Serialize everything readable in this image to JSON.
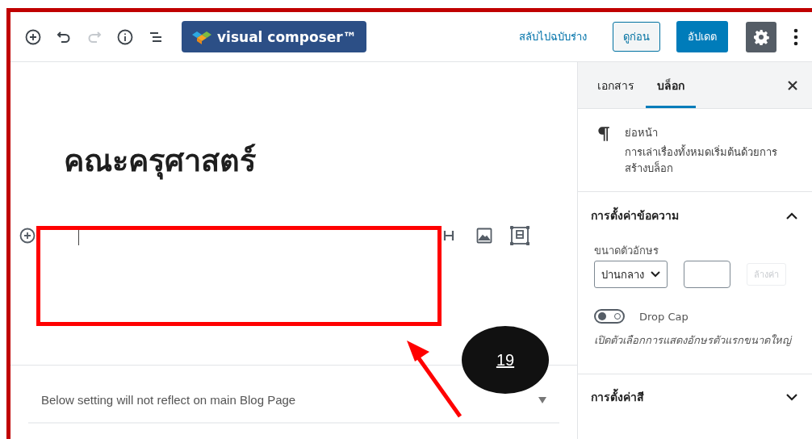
{
  "toolbar": {
    "tools": [
      {
        "kind": "add",
        "disabled": false
      },
      {
        "kind": "undo",
        "disabled": false
      },
      {
        "kind": "redo",
        "disabled": true
      },
      {
        "kind": "info",
        "disabled": false
      },
      {
        "kind": "outline",
        "disabled": false
      }
    ],
    "logo": "visual composer™",
    "switch_to_draft": "สลับไปฉบับร่าง",
    "preview": "ดูก่อน",
    "update": "อัปเดต",
    "settings_selected": true
  },
  "editor": {
    "title": "คณะครุศาสตร์",
    "block_tools": [
      {
        "kind": "heading"
      },
      {
        "kind": "image"
      },
      {
        "kind": "gallery"
      }
    ],
    "panel": {
      "label": "Below setting will not reflect on main Blog Page",
      "expanded": false
    }
  },
  "sidebar": {
    "tabs": [
      {
        "label": "เอกสาร",
        "selected": false
      },
      {
        "label": "บล็อก",
        "selected": true
      }
    ],
    "block": {
      "name": "ย่อหน้า",
      "description": "การเล่าเรื่องทั้งหมดเริ่มต้นด้วยการสร้างบล็อก"
    },
    "text_settings": {
      "title": "การตั้งค่าข้อความ",
      "expanded": true,
      "font_size_label": "ขนาดตัวอักษร",
      "font_size": "ปานกลาง",
      "clear_button": {
        "label": "ล้างค่า",
        "disabled": true
      },
      "drop_cap": {
        "label": "Drop Cap",
        "on": false
      },
      "help": "เปิดตัวเลือกการแสดงอักษรตัวแรกขนาดใหญ่"
    },
    "color_settings": {
      "title": "การตั้งค่าสี",
      "expanded": false
    }
  },
  "annotation": {
    "label": "19"
  }
}
